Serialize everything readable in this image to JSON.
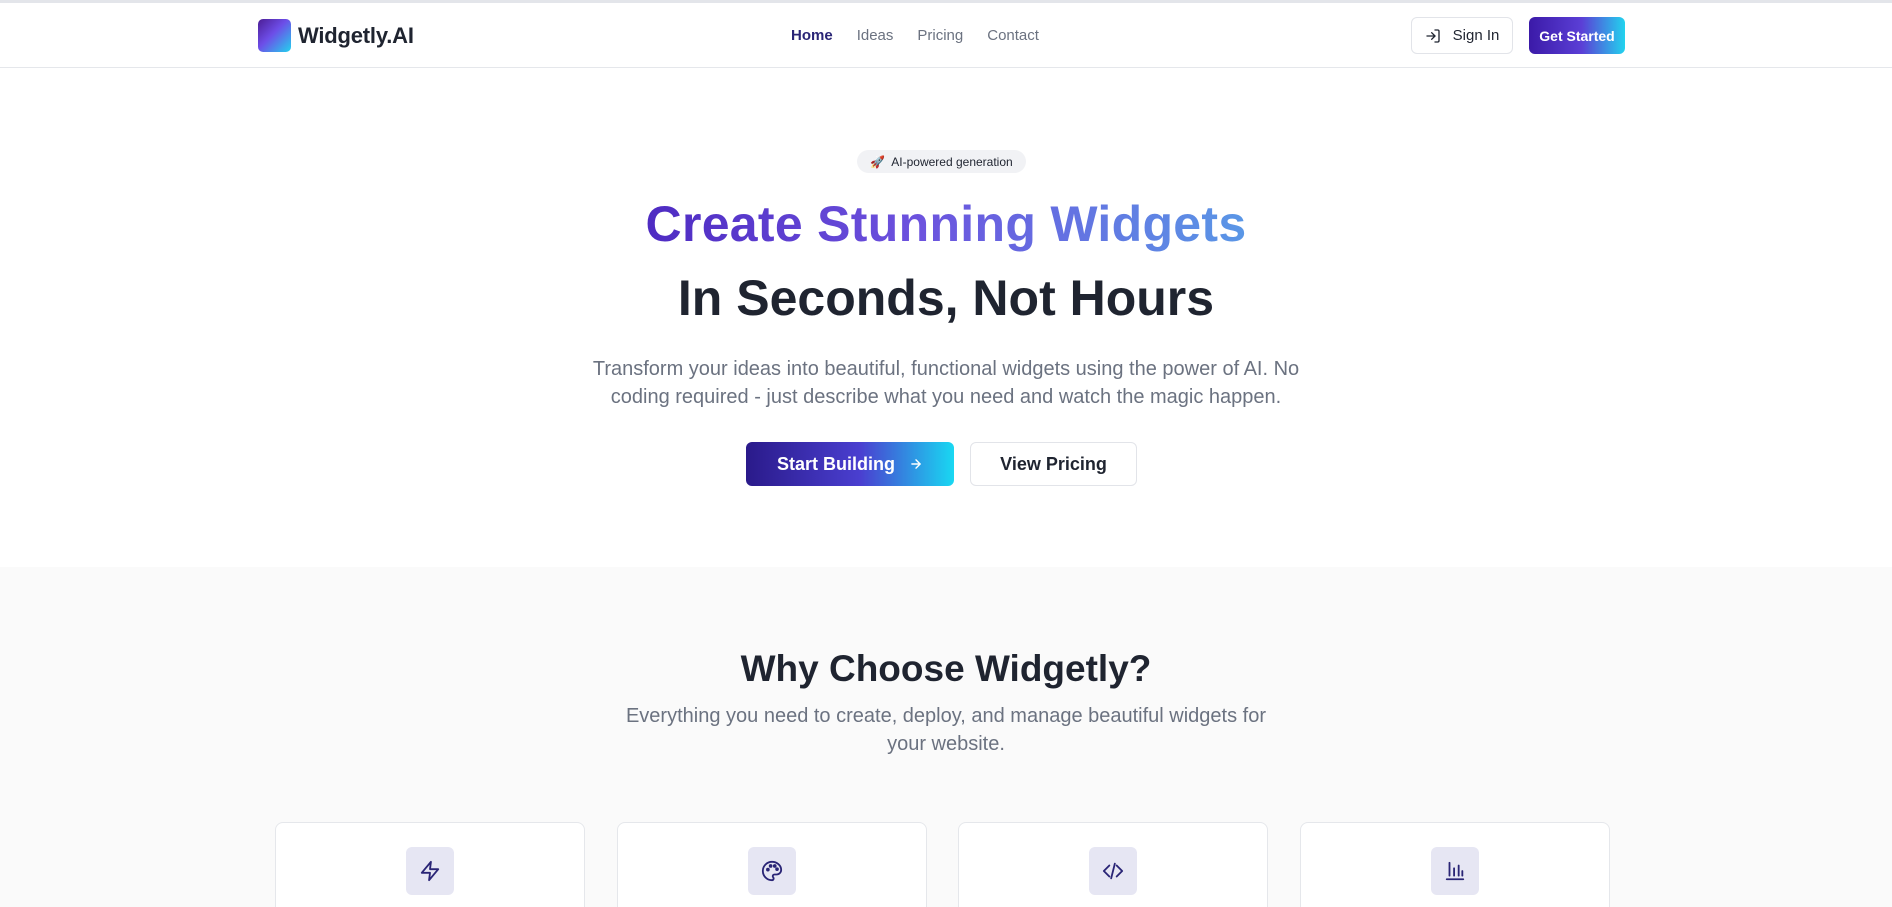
{
  "brand": {
    "name": "Widgetly.AI"
  },
  "nav": {
    "items": [
      {
        "label": "Home",
        "active": true
      },
      {
        "label": "Ideas",
        "active": false
      },
      {
        "label": "Pricing",
        "active": false
      },
      {
        "label": "Contact",
        "active": false
      }
    ]
  },
  "header": {
    "sign_in_label": "Sign In",
    "get_started_label": "Get Started"
  },
  "hero": {
    "badge_icon": "rocket-icon",
    "badge_label": "AI-powered generation",
    "title_line1": "Create Stunning Widgets",
    "title_line2": "In Seconds, Not Hours",
    "subtitle": "Transform your ideas into beautiful, functional widgets using the power of AI. No coding required - just describe what you need and watch the magic happen.",
    "primary_cta": "Start Building",
    "secondary_cta": "View Pricing"
  },
  "features": {
    "title": "Why Choose Widgetly?",
    "subtitle": "Everything you need to create, deploy, and manage beautiful widgets for your website.",
    "cards": [
      {
        "icon": "lightning-icon"
      },
      {
        "icon": "palette-icon"
      },
      {
        "icon": "code-icon"
      },
      {
        "icon": "bar-chart-icon"
      }
    ]
  },
  "colors": {
    "accent_dark": "#2a2576",
    "accent_gradient_start": "#3b1aa8",
    "accent_gradient_end": "#22d3ee",
    "icon_tile_bg": "#e6e6f3"
  }
}
